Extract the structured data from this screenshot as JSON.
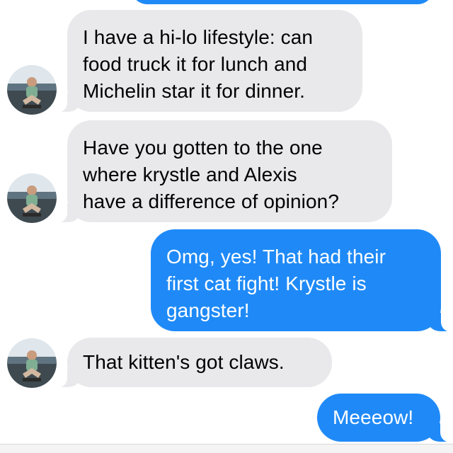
{
  "conversation": {
    "messages": [
      {
        "direction": "incoming",
        "text": "I have a hi-lo lifestyle: can\nfood truck it for lunch and\nMichelin star it for dinner."
      },
      {
        "direction": "incoming",
        "text": "Have you gotten to the one\nwhere krystle and Alexis\nhave a difference of opinion?"
      },
      {
        "direction": "outgoing",
        "text": "Omg, yes!  That had their\nfirst cat fight! Krystle is\ngangster!"
      },
      {
        "direction": "incoming",
        "text": "That kitten's got claws."
      },
      {
        "direction": "outgoing",
        "text": "Meeeow!"
      }
    ]
  },
  "colors": {
    "outgoing_bubble": "#1f8af7",
    "incoming_bubble": "#e9e9eb",
    "background": "#ffffff"
  },
  "icons": {
    "avatar": "contact-avatar-photo"
  }
}
